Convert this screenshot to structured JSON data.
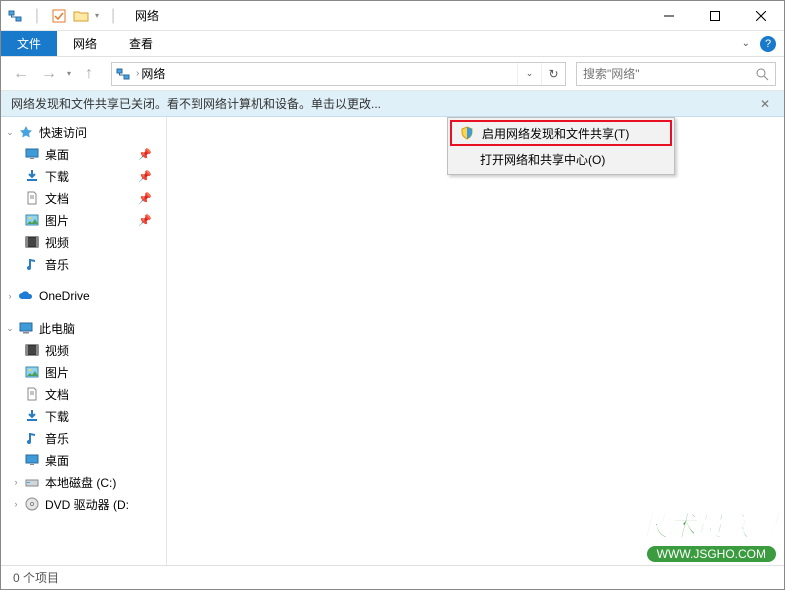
{
  "titlebar": {
    "qat": {
      "checkmark": true
    },
    "title": "网络"
  },
  "ribbon": {
    "file": "文件",
    "tabs": [
      "网络",
      "查看"
    ]
  },
  "navbar": {
    "location": "网络",
    "search_placeholder": "搜索\"网络\""
  },
  "infobar": {
    "text": "网络发现和文件共享已关闭。看不到网络计算机和设备。单击以更改..."
  },
  "context_menu": {
    "items": [
      {
        "label": "启用网络发现和文件共享(T)",
        "icon": "shield",
        "highlight": true
      },
      {
        "label": "打开网络和共享中心(O)",
        "icon": "",
        "highlight": false
      }
    ]
  },
  "sidebar": {
    "quick_access": {
      "label": "快速访问",
      "expanded": true
    },
    "quick_items": [
      {
        "label": "桌面",
        "icon": "desktop",
        "pinned": true
      },
      {
        "label": "下载",
        "icon": "download",
        "pinned": true
      },
      {
        "label": "文档",
        "icon": "document",
        "pinned": true
      },
      {
        "label": "图片",
        "icon": "picture",
        "pinned": true
      },
      {
        "label": "视频",
        "icon": "video",
        "pinned": false
      },
      {
        "label": "音乐",
        "icon": "music",
        "pinned": false
      }
    ],
    "onedrive": {
      "label": "OneDrive"
    },
    "this_pc": {
      "label": "此电脑",
      "expanded": true
    },
    "pc_items": [
      {
        "label": "视频",
        "icon": "video"
      },
      {
        "label": "图片",
        "icon": "picture"
      },
      {
        "label": "文档",
        "icon": "document"
      },
      {
        "label": "下载",
        "icon": "download"
      },
      {
        "label": "音乐",
        "icon": "music"
      },
      {
        "label": "桌面",
        "icon": "desktop"
      },
      {
        "label": "本地磁盘 (C:)",
        "icon": "disk"
      },
      {
        "label": "DVD 驱动器 (D:",
        "icon": "dvd"
      }
    ]
  },
  "statusbar": {
    "item_count": "0 个项目"
  },
  "watermark": {
    "brand": "技术员联盟",
    "url": "WWW.JSGHO.COM"
  }
}
